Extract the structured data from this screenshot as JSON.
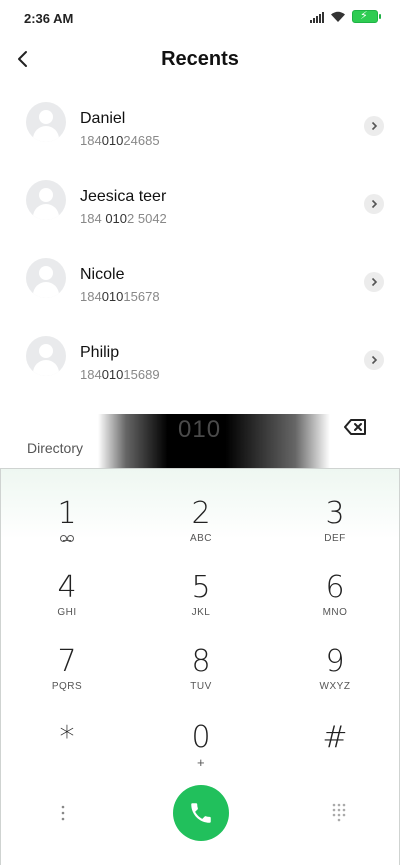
{
  "status_bar": {
    "time": "2:36 AM",
    "icons": [
      "signal-icon",
      "wifi-icon",
      "battery-charging-icon"
    ],
    "battery_color": "#2ecc52"
  },
  "header": {
    "title": "Recents",
    "back_icon": "back-arrow-icon"
  },
  "contacts": [
    {
      "name": "Daniel",
      "number_pre": "184",
      "number_match": "010",
      "number_post": "24685"
    },
    {
      "name": "Jeesica teer",
      "number_pre": "184 ",
      "number_match": "010",
      "number_post": "2 5042"
    },
    {
      "name": "Nicole",
      "number_pre": "184",
      "number_match": "010",
      "number_post": "15678"
    },
    {
      "name": "Philip",
      "number_pre": "184",
      "number_match": "010",
      "number_post": "15689"
    }
  ],
  "input": {
    "typed_number": "010",
    "directory_label": "Directory",
    "backspace_icon": "backspace-icon"
  },
  "dialpad": {
    "keys": [
      {
        "digit": "1",
        "letters": ""
      },
      {
        "digit": "2",
        "letters": "ABC"
      },
      {
        "digit": "3",
        "letters": "DEF"
      },
      {
        "digit": "4",
        "letters": "GHI"
      },
      {
        "digit": "5",
        "letters": "JKL"
      },
      {
        "digit": "6",
        "letters": "MNO"
      },
      {
        "digit": "7",
        "letters": "PQRS"
      },
      {
        "digit": "8",
        "letters": "TUV"
      },
      {
        "digit": "9",
        "letters": "WXYZ"
      },
      {
        "digit": "*",
        "letters": ""
      },
      {
        "digit": "0",
        "letters": "+"
      },
      {
        "digit": "#",
        "letters": ""
      }
    ],
    "call_color": "#21c05c",
    "accent_tint": "#eef7f1"
  }
}
